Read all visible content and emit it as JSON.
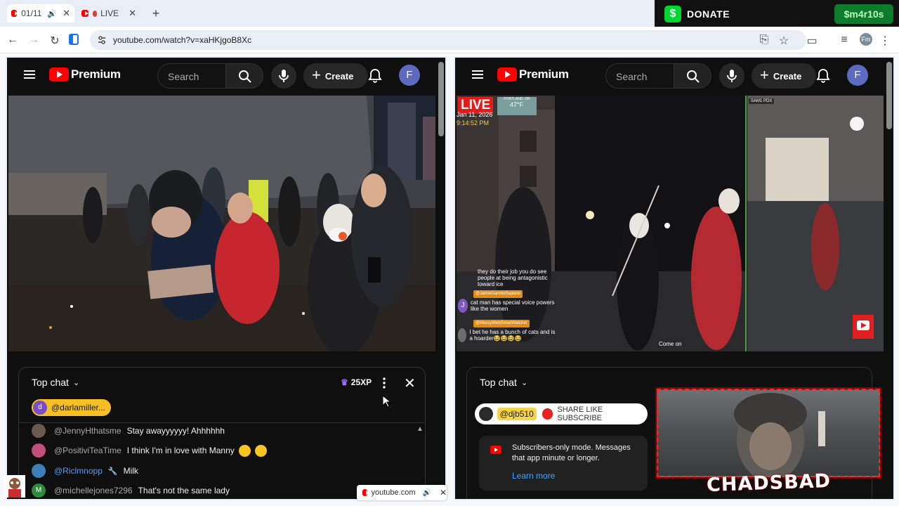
{
  "browser": {
    "tabs": [
      {
        "label": "01/11",
        "active": true
      },
      {
        "label": "LIVE",
        "active": false
      }
    ],
    "url": "youtube.com/watch?v=xaHKjgoB8Xc"
  },
  "donate": {
    "label": "DONATE",
    "cashtag": "$m4r10s",
    "brand_color": "#00d632"
  },
  "left": {
    "logo": "Premium",
    "search_placeholder": "Search",
    "create_label": "Create",
    "avatar_letter": "F",
    "chat": {
      "title": "Top chat",
      "xp": "25XP",
      "pinned": {
        "initial": "d",
        "name": "@darlamiller..."
      },
      "messages": [
        {
          "author": "@JennyHthatsme",
          "text": "Stay awayyyyyy! Ahhhhhh",
          "avatar_color": "#6b5a4e"
        },
        {
          "author": "@PositiviTeaTime",
          "text": "I think I'm in love with Manny",
          "avatar_color": "#c24e7a",
          "emoji_count": 2
        },
        {
          "author": "@Riclmnopp",
          "text": "Milk",
          "avatar_color": "#3f7fb8"
        },
        {
          "author": "@michellejones7296",
          "text": "That's not the same lady",
          "avatar_color": "#2e8b3e",
          "initial": "M"
        }
      ]
    }
  },
  "right": {
    "logo": "Premium",
    "search_placeholder": "Search",
    "create_label": "Create",
    "avatar_letter": "F",
    "overlay": {
      "live": "LIVE",
      "date": "Jan 11, 2026",
      "time": "9:14:52 PM",
      "city": "PORTLAND, OR",
      "temp": "47°F",
      "camera_tag": "SAM1 PDX",
      "caption": "Come on",
      "chat_lines": [
        {
          "name": "",
          "text": "they do their job you do see people at being antagonistic toward ice"
        },
        {
          "name": "@JamieGarridoSapiano",
          "text": "cat man has special voice powers like the women"
        },
        {
          "name": "@MessyWebStreetWatcher",
          "text": "I bet he has a bunch of cats and is a hoarder😂😂😂😂"
        }
      ]
    },
    "chat": {
      "title": "Top chat",
      "banner_user": "@djb510",
      "banner_text": "SHARE LIKE SUBSCRIBE",
      "notice": "Subscribers-only mode. Messages that app minute or longer.",
      "learn_more": "Learn more"
    }
  },
  "streamer": {
    "name": "CHADSBAD"
  },
  "pip": {
    "domain": "youtube.com"
  }
}
